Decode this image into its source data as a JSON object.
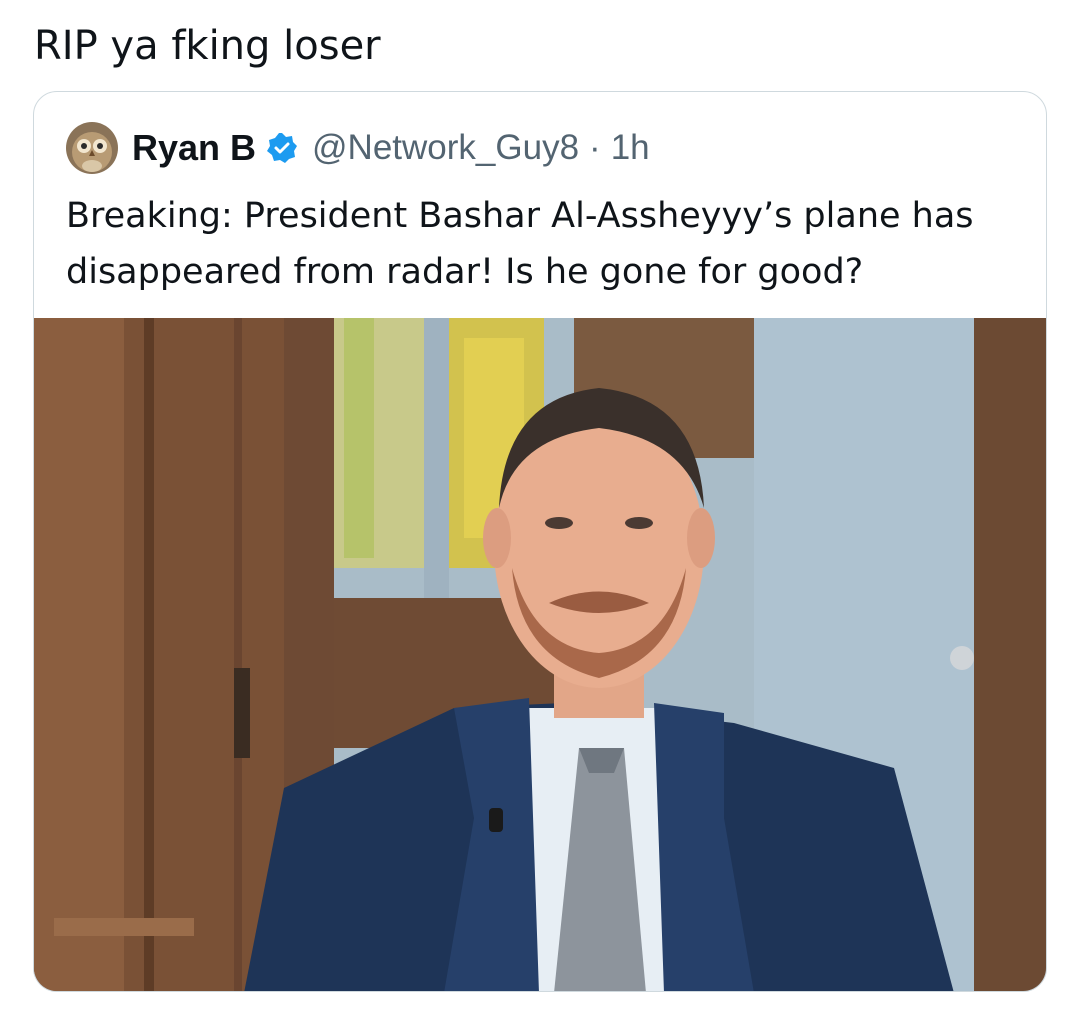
{
  "post": {
    "text": "RIP ya fking loser"
  },
  "quoted_post": {
    "display_name": "Ryan B",
    "handle": "@Network_Guy8",
    "separator": "·",
    "time": "1h",
    "text": "Breaking: President Bashar Al-Assheyyy’s plane has disappeared from radar!  Is he gone for good?",
    "verified": true,
    "avatar": "owl-avatar",
    "media": "photo-man-in-suit-interview"
  },
  "colors": {
    "text": "#0f1419",
    "secondary_text": "#536471",
    "border": "#cfd9de",
    "verified_blue": "#1d9bf0"
  }
}
